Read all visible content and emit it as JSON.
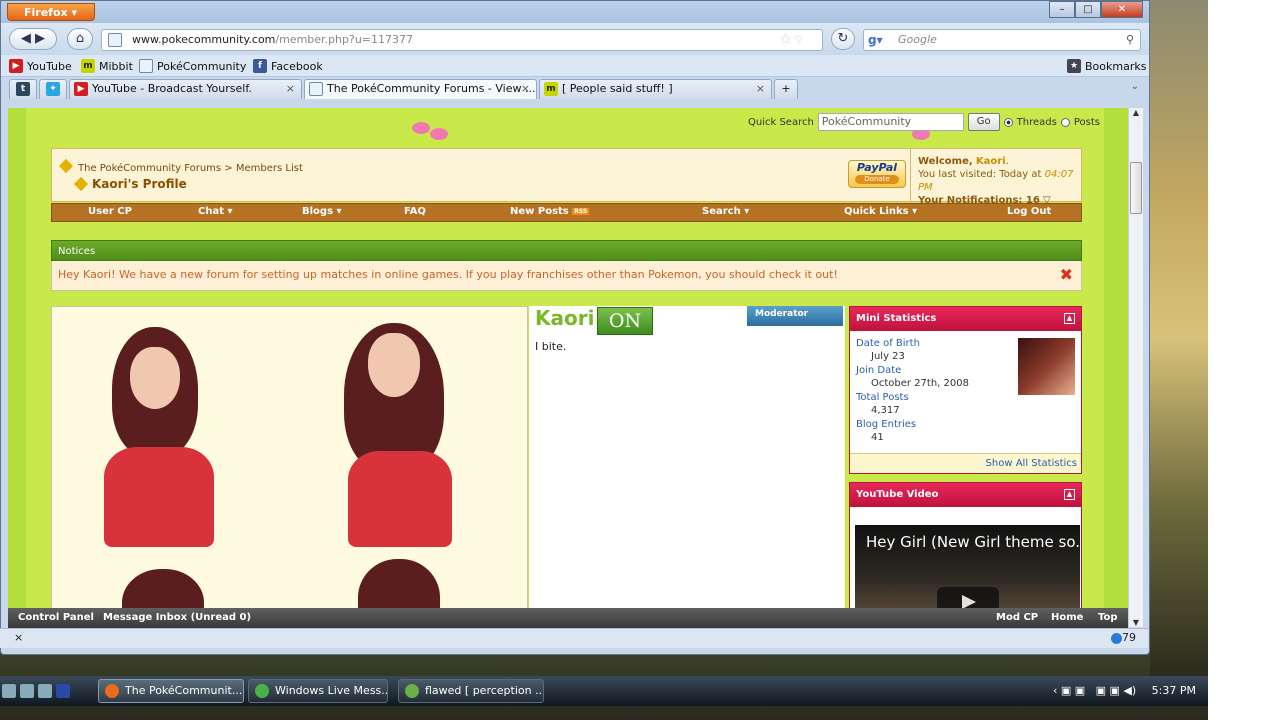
{
  "browser": {
    "app_button": "Firefox",
    "url_domain": "www.pokecommunity.com",
    "url_path": "/member.php?u=117377",
    "search_placeholder": "Google",
    "bookmarks": [
      "YouTube",
      "Mibbit",
      "PokéCommunity",
      "Facebook"
    ],
    "bookmarks_menu": "Bookmarks",
    "tabs": [
      {
        "label": "YouTube - Broadcast Yourself."
      },
      {
        "label": "The PokéCommunity Forums - View ..."
      },
      {
        "label": "[ People said stuff! ]"
      }
    ],
    "new_tab": "+"
  },
  "page": {
    "quick_search_label": "Quick Search",
    "quick_search_value": "PokéCommunity",
    "go_label": "Go",
    "radio_threads": "Threads",
    "radio_posts": "Posts",
    "breadcrumb_root": "The PokéCommunity Forums > Members List",
    "breadcrumb_current": "Kaori's Profile",
    "paypal": "PayPal",
    "paypal_sub": "Donate",
    "welcome_prefix": "Welcome,",
    "welcome_user": "Kaori",
    "last_visited": "You last visited: Today at",
    "last_visited_time": "04:07 PM",
    "notifications": "Your Notifications: 16",
    "menu": [
      "User CP",
      "Chat ▾",
      "Blogs ▾",
      "FAQ",
      "New Posts",
      "Search ▾",
      "Quick Links ▾",
      "Log Out"
    ],
    "rss": "RSS",
    "notices_title": "Notices",
    "notice_text": "Hey Kaori! We have a new forum for setting up matches in online games. If you play franchises other than Pokemon, you should check it out!"
  },
  "profile": {
    "username": "Kaori",
    "status": "ON",
    "role": "Moderator",
    "motto": "I bite."
  },
  "mini_stats": {
    "title": "Mini Statistics",
    "items": [
      {
        "label": "Date of Birth",
        "value": "July 23"
      },
      {
        "label": "Join Date",
        "value": "October 27th, 2008"
      },
      {
        "label": "Total Posts",
        "value": "4,317"
      },
      {
        "label": "Blog Entries",
        "value": "41"
      }
    ],
    "show_all": "Show All Statistics"
  },
  "youtube": {
    "title": "YouTube Video",
    "video_title": "Hey Girl (New Girl theme so."
  },
  "bottom_bar": {
    "left": [
      "Control Panel",
      "Message Inbox (Unread 0)"
    ],
    "right": [
      "Mod CP",
      "Home",
      "Top"
    ]
  },
  "status_bar": {
    "close": "×",
    "count": "79"
  },
  "taskbar": {
    "items": [
      "The PokéCommunit...",
      "Windows Live Mess...",
      "flawed [ perception ..."
    ],
    "clock": "5:37 PM"
  }
}
